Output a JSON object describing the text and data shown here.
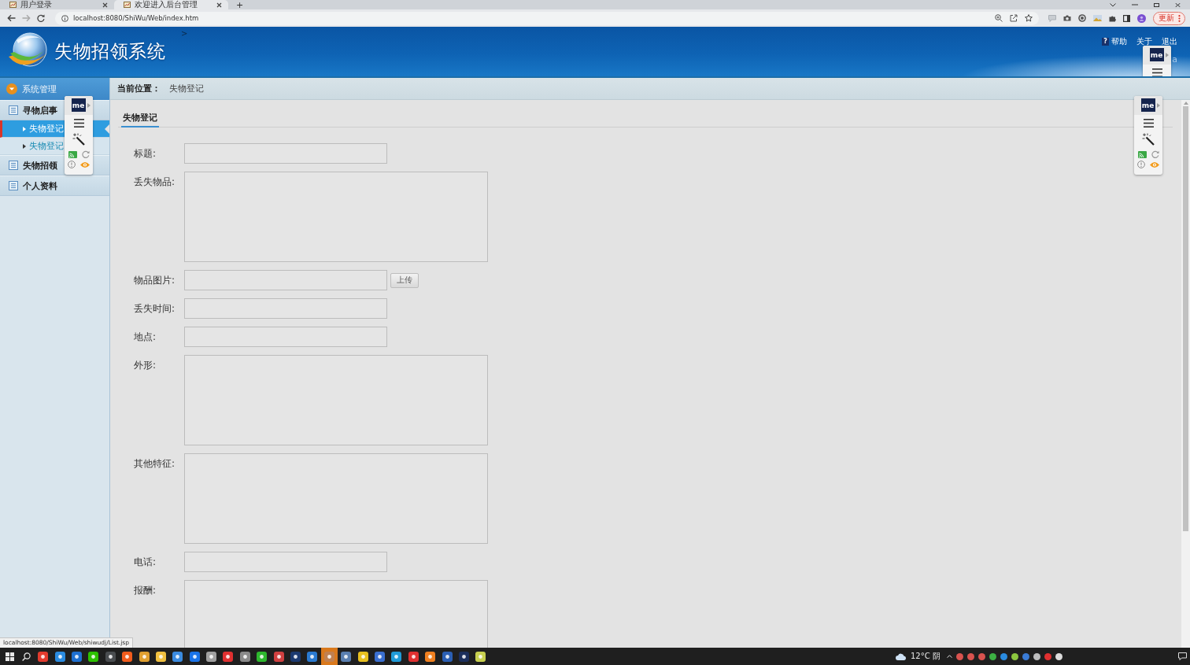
{
  "browser": {
    "tabs": [
      {
        "title": "用户登录",
        "selected": false
      },
      {
        "title": "欢迎进入后台管理",
        "selected": true
      }
    ],
    "new_tab": "+",
    "url": "localhost:8080/ShiWu/Web/index.htm",
    "update_button": "更新"
  },
  "header": {
    "title": "失物招领系统",
    "marker": ">",
    "links": [
      {
        "label": "帮助",
        "icon": "?"
      },
      {
        "label": "关于"
      },
      {
        "label": "退出"
      }
    ],
    "user_fragment": "a",
    "extension_panel": {
      "badge": "me",
      "kind": "clipped"
    }
  },
  "sidebar": {
    "section": "系统管理",
    "groups": [
      {
        "label": "寻物启事",
        "children": [
          {
            "label": "失物登记",
            "selected": true
          },
          {
            "label": "失物登记",
            "selected": false
          }
        ]
      },
      {
        "label": "失物招领"
      },
      {
        "label": "个人资料"
      }
    ],
    "extension_panel": {
      "badge": "me",
      "kind": "full"
    }
  },
  "breadcrumb": {
    "label": "当前位置：",
    "value": "失物登记"
  },
  "form": {
    "tabs": [
      {
        "label": "失物登记",
        "selected": true
      }
    ],
    "fields": [
      {
        "label": "标题:",
        "kind": "input"
      },
      {
        "label": "丢失物品:",
        "kind": "textarea"
      },
      {
        "label": "物品图片:",
        "kind": "upload",
        "button": "上传"
      },
      {
        "label": "丢失时间:",
        "kind": "input"
      },
      {
        "label": "地点:",
        "kind": "input"
      },
      {
        "label": "外形:",
        "kind": "textarea"
      },
      {
        "label": "其他特征:",
        "kind": "textarea"
      },
      {
        "label": "电话:",
        "kind": "input"
      },
      {
        "label": "报酬:",
        "kind": "textarea"
      }
    ],
    "extension_panel": {
      "badge": "me",
      "kind": "full"
    }
  },
  "status_url": "localhost:8080/ShiWu/Web/shiwudj/List.jsp",
  "taskbar": {
    "apps": [
      {
        "color": "#e23b2e",
        "selected": false
      },
      {
        "color": "#2a8be0",
        "selected": false
      },
      {
        "color": "#1e6fd0",
        "selected": false
      },
      {
        "color": "#2dc100",
        "selected": false
      },
      {
        "color": "#4a4d50",
        "selected": false
      },
      {
        "color": "#f25c1c",
        "selected": false
      },
      {
        "color": "#e0a030",
        "selected": false
      },
      {
        "color": "#f0c040",
        "selected": false
      },
      {
        "color": "#3b8be0",
        "selected": false
      },
      {
        "color": "#1a73e8",
        "selected": false
      },
      {
        "color": "#a0a0a0",
        "selected": false
      },
      {
        "color": "#e03030",
        "selected": false
      },
      {
        "color": "#8a8a8a",
        "selected": false
      },
      {
        "color": "#2eb82e",
        "selected": false
      },
      {
        "color": "#d04040",
        "selected": false
      },
      {
        "color": "#1c3a70",
        "selected": false
      },
      {
        "color": "#2a7ad0",
        "selected": false
      },
      {
        "color": "#c08050",
        "selected": true
      },
      {
        "color": "#5a7fb0",
        "selected": false
      },
      {
        "color": "#e8c020",
        "selected": false
      },
      {
        "color": "#3a6fd0",
        "selected": false
      },
      {
        "color": "#1f9bd8",
        "selected": false
      },
      {
        "color": "#e03131",
        "selected": false
      },
      {
        "color": "#f08020",
        "selected": false
      },
      {
        "color": "#2b5fb4",
        "selected": false
      },
      {
        "color": "#1c2f5c",
        "selected": false
      },
      {
        "color": "#c8d050",
        "selected": false
      }
    ],
    "weather": "12°C 阴"
  }
}
